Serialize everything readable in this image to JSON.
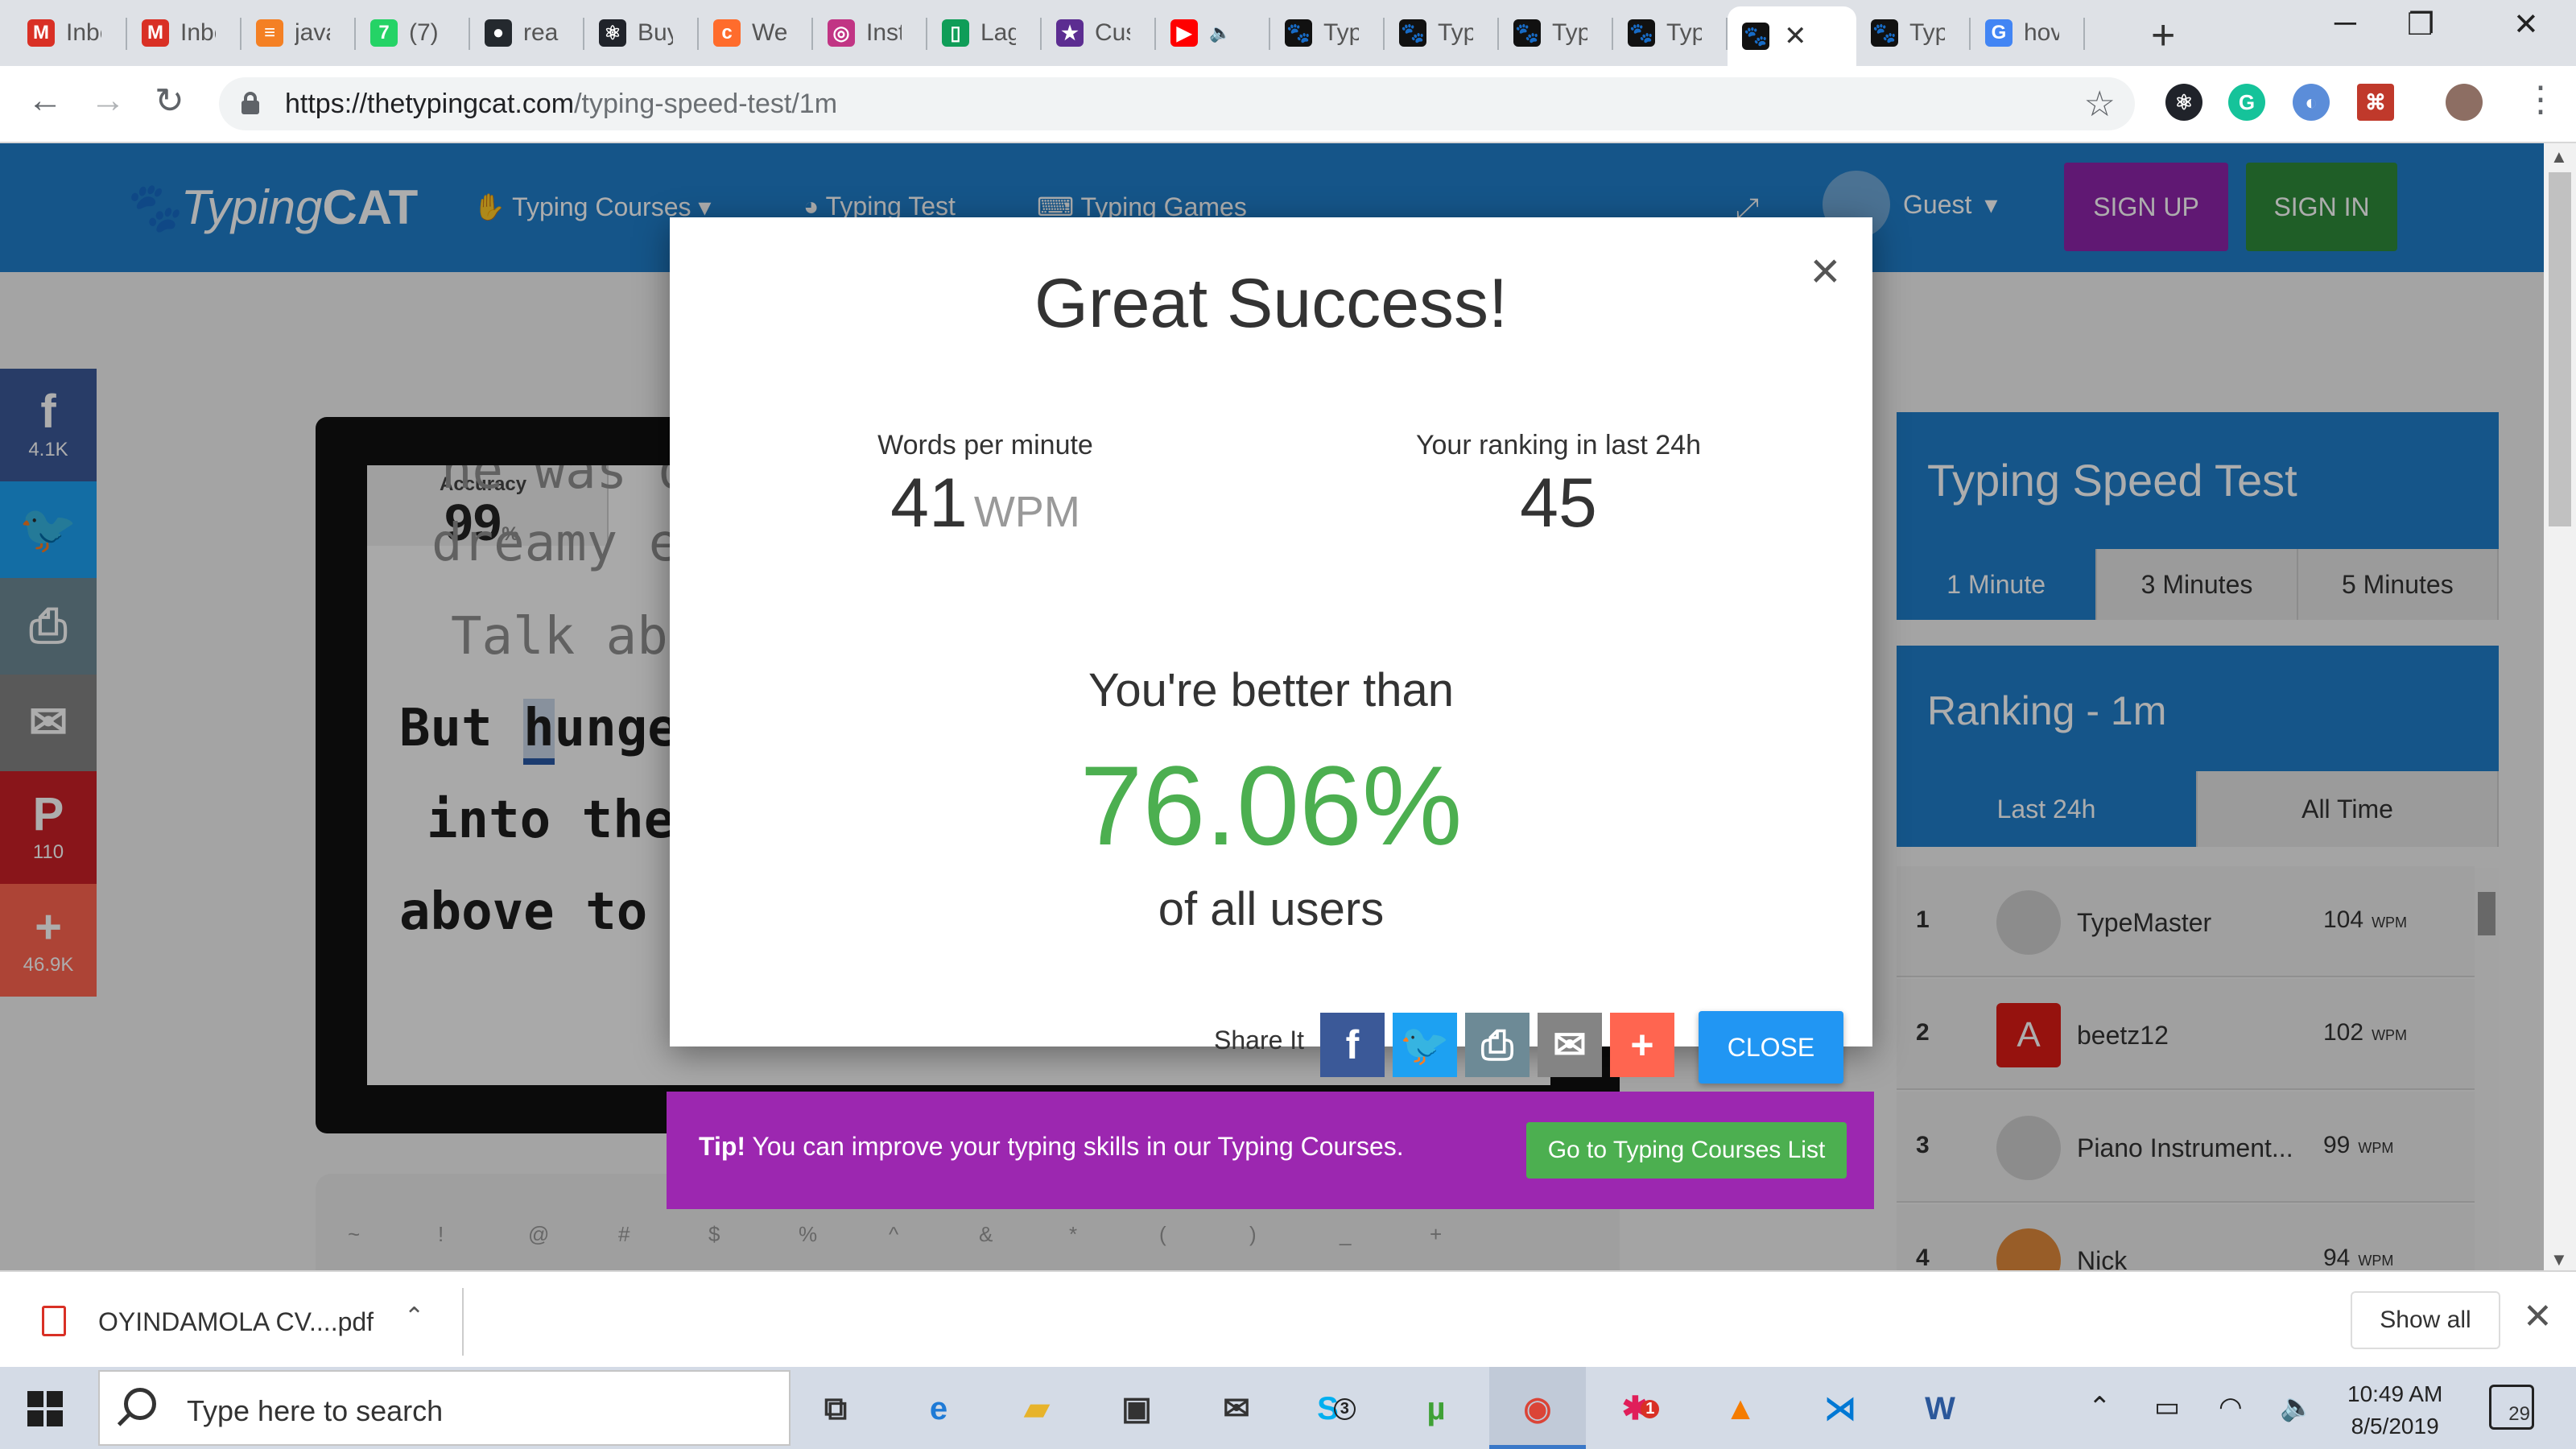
{
  "browser": {
    "tabs": [
      {
        "title": "Inbox",
        "icon": "gmail-icon",
        "glyph": "M",
        "color": "#d93025"
      },
      {
        "title": "Inbox",
        "icon": "gmail-icon",
        "glyph": "M",
        "color": "#d93025"
      },
      {
        "title": "java",
        "icon": "stackoverflow-icon",
        "glyph": "≡",
        "color": "#f48024"
      },
      {
        "title": "(7)",
        "icon": "whatsapp-icon",
        "glyph": "7",
        "color": "#25d366"
      },
      {
        "title": "rea",
        "icon": "github-icon",
        "glyph": "●",
        "color": "#24292e"
      },
      {
        "title": "Buy",
        "icon": "react-icon",
        "glyph": "⚛",
        "color": "#20232a"
      },
      {
        "title": "We",
        "icon": "cpanel-icon",
        "glyph": "c",
        "color": "#ff6c2c"
      },
      {
        "title": "Inst",
        "icon": "instagram-icon",
        "glyph": "◎",
        "color": "#c13584"
      },
      {
        "title": "Lag",
        "icon": "document-icon",
        "glyph": "▯",
        "color": "#0f9d58"
      },
      {
        "title": "Cus",
        "icon": "star-icon",
        "glyph": "★",
        "color": "#5c2d91"
      },
      {
        "title": "",
        "icon": "youtube-icon",
        "glyph": "▶",
        "color": "#ff0000"
      },
      {
        "title": "Typ",
        "icon": "paw-icon",
        "glyph": "🐾",
        "color": "#111111"
      },
      {
        "title": "Typ",
        "icon": "paw-icon",
        "glyph": "🐾",
        "color": "#111111"
      },
      {
        "title": "Typ",
        "icon": "paw-icon",
        "glyph": "🐾",
        "color": "#111111"
      },
      {
        "title": "Typ",
        "icon": "paw-icon",
        "glyph": "🐾",
        "color": "#111111"
      },
      {
        "title": "",
        "icon": "paw-icon",
        "glyph": "🐾",
        "color": "#111111",
        "active": true
      },
      {
        "title": "Typ",
        "icon": "paw-icon",
        "glyph": "🐾",
        "color": "#111111"
      },
      {
        "title": "hov",
        "icon": "google-icon",
        "glyph": "G",
        "color": "#4285f4"
      }
    ],
    "url_host": "https://thetypingcat.com",
    "url_path": "/typing-speed-test/1m"
  },
  "site": {
    "logo_light": "Typing",
    "logo_bold": "CAT",
    "nav": [
      "Typing Courses",
      "Typing Test",
      "Typing Games"
    ],
    "guest": "Guest",
    "signup": "SIGN UP",
    "signin": "SIGN IN"
  },
  "social": [
    {
      "icon": "facebook-icon",
      "glyph": "f",
      "count": "4.1K",
      "color": "#3b5998"
    },
    {
      "icon": "twitter-icon",
      "glyph": "🐦",
      "count": "",
      "color": "#1da1f2"
    },
    {
      "icon": "print-icon",
      "glyph": "⎙",
      "count": "",
      "color": "#6d8a96"
    },
    {
      "icon": "email-icon",
      "glyph": "✉",
      "count": "",
      "color": "#848484"
    },
    {
      "icon": "pinterest-icon",
      "glyph": "P",
      "count": "110",
      "color": "#cb2027"
    },
    {
      "icon": "plus-icon",
      "glyph": "+",
      "count": "46.9K",
      "color": "#ff6550"
    }
  ],
  "typing": {
    "accuracy_label": "Accuracy",
    "accuracy_value": "99",
    "accuracy_unit": "%",
    "lines": [
      {
        "text": "he was d",
        "style": "muted"
      },
      {
        "text": "dreamy e",
        "style": "muted"
      },
      {
        "text": " Talk abo",
        "style": "muted"
      },
      {
        "text": "But hunger",
        "style": "dark",
        "highlight": "h"
      },
      {
        "text": " into the",
        "style": "dark"
      },
      {
        "text": "above to t",
        "style": "dark"
      }
    ]
  },
  "speed_test": {
    "title": "Typing Speed Test",
    "durations": [
      "1 Minute",
      "3 Minutes",
      "5 Minutes"
    ],
    "active_duration": 0
  },
  "ranking": {
    "title": "Ranking - 1m",
    "tabs": [
      "Last 24h",
      "All Time"
    ],
    "active_tab": 0,
    "unit": "WPM",
    "rows": [
      {
        "rank": "1",
        "name": "TypeMaster",
        "wpm": "104",
        "avatar": "github-avatar-icon"
      },
      {
        "rank": "2",
        "name": "beetz12",
        "wpm": "102",
        "avatar": "angular-avatar-icon"
      },
      {
        "rank": "3",
        "name": "Piano Instrument...",
        "wpm": "99",
        "avatar": "github-avatar-icon"
      },
      {
        "rank": "4",
        "name": "Nick",
        "wpm": "94",
        "avatar": "fox-avatar-icon"
      }
    ]
  },
  "modal": {
    "title": "Great Success!",
    "wpm_label": "Words per minute",
    "wpm_value": "41",
    "wpm_unit": "WPM",
    "rank_label": "Your ranking in last 24h",
    "rank_value": "45",
    "better_than": "You're better than",
    "percent": "76.06%",
    "of_users": "of all users",
    "share_label": "Share It",
    "close_label": "CLOSE",
    "share_buttons": [
      {
        "icon": "facebook-icon",
        "glyph": "f",
        "color": "#3b5998"
      },
      {
        "icon": "twitter-icon",
        "glyph": "🐦",
        "color": "#1da1f2"
      },
      {
        "icon": "print-icon",
        "glyph": "⎙",
        "color": "#6d8a96"
      },
      {
        "icon": "email-icon",
        "glyph": "✉",
        "color": "#848484"
      },
      {
        "icon": "plus-icon",
        "glyph": "+",
        "color": "#ff6550"
      }
    ]
  },
  "tip": {
    "bold": "Tip!",
    "text": "You can improve your typing skills in our Typing Courses.",
    "button": "Go to Typing Courses List"
  },
  "download": {
    "filename": "OYINDAMOLA CV....pdf",
    "show_all": "Show all"
  },
  "taskbar": {
    "search_placeholder": "Type here to search",
    "time": "10:49 AM",
    "date": "8/5/2019",
    "notifications": "29",
    "skype_badge": "3",
    "slack_badge": "1"
  },
  "colors": {
    "brand_blue": "#1f7ecb",
    "success_green": "#4caf50",
    "tip_purple": "#9c27b0",
    "close_blue": "#2196f3"
  }
}
